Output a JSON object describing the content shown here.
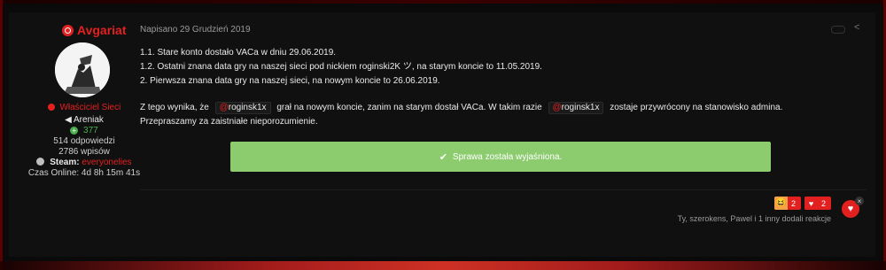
{
  "author": {
    "name": "Avgariat",
    "role": "Właściciel Sieci",
    "rank": "Areniak",
    "reputation": "377",
    "answers": "514 odpowiedzi",
    "posts": "2786 wpisów",
    "steam_label": "Steam:",
    "steam_value": "everyonelies",
    "online": "Czas Online: 4d 8h 15m 41s"
  },
  "post": {
    "meta": "Napisano 29 Grudzień 2019",
    "lines": [
      "1.1. Stare konto dostało VACa w dniu 29.06.2019.",
      "1.2. Ostatni znana data gry na naszej sieci pod nickiem roginski2K ツ, na starym koncie to 11.05.2019.",
      "2. Pierwsza znana data gry na naszej sieci, na nowym koncie to 26.06.2019."
    ],
    "para2": {
      "a": "Z tego wynika, że",
      "mention1": "roginsk1x",
      "b": "grał na nowym koncie, zanim na starym dostał VACa.  W takim razie",
      "mention2": "roginsk1x",
      "c": "zostaje przywrócony na stanowisko admina."
    },
    "sorry": "Przepraszamy za zaistniałe nieporozumienie.",
    "notice": "Sprawa została wyjaśniona."
  },
  "reactions": {
    "items": [
      {
        "icon": "haha-icon",
        "count": "2"
      },
      {
        "icon": "heart-icon",
        "count": "2"
      }
    ],
    "summary": "Ty, szerokens, Pawel i 1 inny dodali reakcje"
  }
}
